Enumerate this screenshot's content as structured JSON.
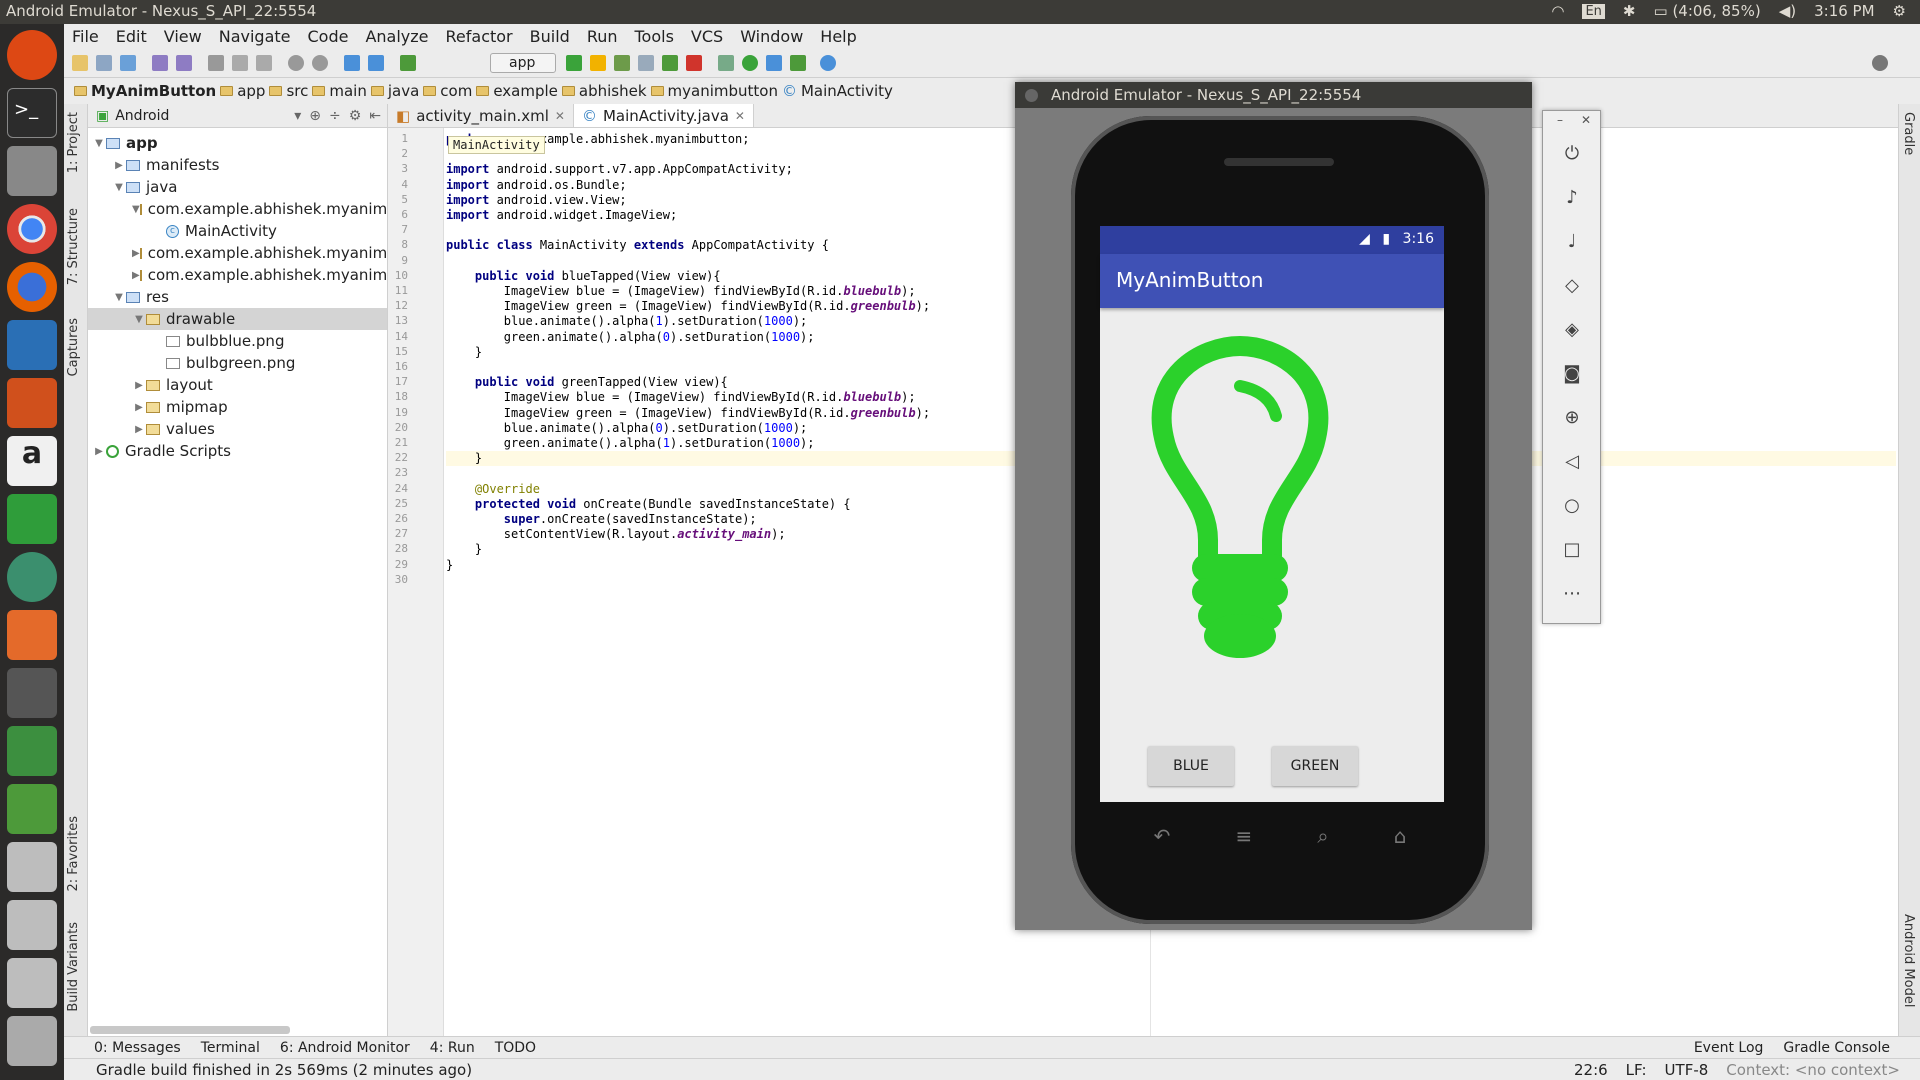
{
  "topbar": {
    "title": "Android Emulator - Nexus_S_API_22:5554",
    "kbd": "En",
    "battery": "(4:06, 85%)",
    "clock": "3:16 PM"
  },
  "menu": [
    "File",
    "Edit",
    "View",
    "Navigate",
    "Code",
    "Analyze",
    "Refactor",
    "Build",
    "Run",
    "Tools",
    "VCS",
    "Window",
    "Help"
  ],
  "toolbar": {
    "run_config": "app"
  },
  "breadcrumbs": [
    "MyAnimButton",
    "app",
    "src",
    "main",
    "java",
    "com",
    "example",
    "abhishek",
    "myanimbutton",
    "MainActivity"
  ],
  "project": {
    "view": "Android",
    "tree": [
      {
        "label": "app",
        "depth": 0,
        "arrow": "▼",
        "icon": "fold",
        "bold": true
      },
      {
        "label": "manifests",
        "depth": 1,
        "arrow": "▶",
        "icon": "fold"
      },
      {
        "label": "java",
        "depth": 1,
        "arrow": "▼",
        "icon": "fold"
      },
      {
        "label": "com.example.abhishek.myaniml",
        "depth": 2,
        "arrow": "▼",
        "icon": "pkg"
      },
      {
        "label": "MainActivity",
        "depth": 3,
        "arrow": "",
        "icon": "cls"
      },
      {
        "label": "com.example.abhishek.myaniml",
        "depth": 2,
        "arrow": "▶",
        "icon": "pkg"
      },
      {
        "label": "com.example.abhishek.myaniml",
        "depth": 2,
        "arrow": "▶",
        "icon": "pkg"
      },
      {
        "label": "res",
        "depth": 1,
        "arrow": "▼",
        "icon": "fold"
      },
      {
        "label": "drawable",
        "depth": 2,
        "arrow": "▼",
        "icon": "pkg",
        "selected": true
      },
      {
        "label": "bulbblue.png",
        "depth": 3,
        "arrow": "",
        "icon": "img"
      },
      {
        "label": "bulbgreen.png",
        "depth": 3,
        "arrow": "",
        "icon": "img"
      },
      {
        "label": "layout",
        "depth": 2,
        "arrow": "▶",
        "icon": "pkg"
      },
      {
        "label": "mipmap",
        "depth": 2,
        "arrow": "▶",
        "icon": "pkg"
      },
      {
        "label": "values",
        "depth": 2,
        "arrow": "▶",
        "icon": "pkg"
      },
      {
        "label": "Gradle Scripts",
        "depth": 0,
        "arrow": "▶",
        "icon": "gr"
      }
    ]
  },
  "side_tabs": {
    "project": "1: Project",
    "structure": "7: Structure",
    "captures": "Captures",
    "favorites": "2: Favorites",
    "build_variants": "Build Variants",
    "gradle": "Gradle",
    "android_model": "Android Model"
  },
  "editor": {
    "tabs": [
      {
        "label": "activity_main.xml",
        "active": false
      },
      {
        "label": "MainActivity.java",
        "active": true
      }
    ],
    "crumb_tip": "MainActivity",
    "lines": [
      "<span class=\"kw\">package</span> com.example.abhishek.myanimbutton;",
      "",
      "<span class=\"kw\">import</span> android.support.v7.app.AppCompatActivity;",
      "<span class=\"kw\">import</span> android.os.Bundle;",
      "<span class=\"kw\">import</span> android.view.View;",
      "<span class=\"kw\">import</span> android.widget.ImageView;",
      "",
      "<span class=\"kw\">public class</span> MainActivity <span class=\"kw\">extends</span> AppCompatActivity {",
      "",
      "    <span class=\"kw\">public void</span> blueTapped(View view){",
      "        ImageView blue = (ImageView) findViewById(R.id.<span class=\"fld2\">bluebulb</span>);",
      "        ImageView green = (ImageView) findViewById(R.id.<span class=\"fld2\">greenbulb</span>);",
      "        blue.animate().alpha(<span class=\"num\">1</span>).setDuration(<span class=\"num\">1000</span>);",
      "        green.animate().alpha(<span class=\"num\">0</span>).setDuration(<span class=\"num\">1000</span>);",
      "    }",
      "",
      "    <span class=\"kw\">public void</span> greenTapped(View view){",
      "        ImageView blue = (ImageView) findViewById(R.id.<span class=\"fld2\">bluebulb</span>);",
      "        ImageView green = (ImageView) findViewById(R.id.<span class=\"fld2\">greenbulb</span>);",
      "        blue.animate().alpha(<span class=\"num\">0</span>).setDuration(<span class=\"num\">1000</span>);",
      "        green.animate().alpha(<span class=\"num\">1</span>).setDuration(<span class=\"num\">1000</span>);",
      "    }",
      "",
      "    <span class=\"ann\">@Override</span>",
      "    <span class=\"kw\">protected void</span> onCreate(Bundle savedInstanceState) {",
      "        <span class=\"kw\">super</span>.onCreate(savedInstanceState);",
      "        setContentView(R.layout.<span class=\"fld2\">activity_main</span>);",
      "    }",
      "}",
      ""
    ],
    "current_line": 22
  },
  "bottom_tabs": [
    "0: Messages",
    "Terminal",
    "6: Android Monitor",
    "4: Run",
    "TODO"
  ],
  "bottom_right": [
    "Event Log",
    "Gradle Console"
  ],
  "status": {
    "message": "Gradle build finished in 2s 569ms (2 minutes ago)",
    "position": "22:6",
    "line_sep": "LF:",
    "encoding": "UTF-8",
    "context": "Context: <no context>"
  },
  "emulator": {
    "title": "Android Emulator - Nexus_S_API_22:5554",
    "phone_time": "3:16",
    "app_title": "MyAnimButton",
    "buttons": [
      "BLUE",
      "GREEN"
    ],
    "bulb_color": "#2bd12b"
  },
  "colors": {
    "app_bar": "#3f51b5",
    "status_bar": "#2f3f9f"
  }
}
